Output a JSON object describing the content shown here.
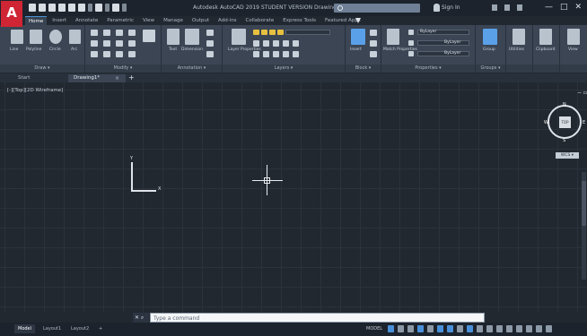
{
  "window": {
    "app_logo": "A",
    "title": "Autodesk AutoCAD 2019  STUDENT VERSION   Drawing1.dwg",
    "signin": "Sign In",
    "controls": [
      "—",
      "□",
      "✕"
    ]
  },
  "ribbon": {
    "tabs": [
      "Home",
      "Insert",
      "Annotate",
      "Parametric",
      "View",
      "Manage",
      "Output",
      "Add-ins",
      "Collaborate",
      "Express Tools",
      "Featured Apps"
    ],
    "active_tab": "Home",
    "panels": [
      {
        "title": "Draw ▾",
        "tools": [
          "Line",
          "Polyline",
          "Circle",
          "Arc"
        ]
      },
      {
        "title": "Modify ▾",
        "tools": []
      },
      {
        "title": "Annotation ▾",
        "tools": [
          "Text",
          "Dimension"
        ]
      },
      {
        "title": "Layers ▾",
        "tools": [
          "Layer Properties"
        ]
      },
      {
        "title": "Block ▾",
        "tools": [
          "Insert"
        ]
      },
      {
        "title": "Properties ▾",
        "tools": [
          "Match Properties"
        ],
        "combos": [
          "ByLayer",
          "ByLayer",
          "ByLayer"
        ]
      },
      {
        "title": "Groups ▾",
        "tools": [
          "Group"
        ]
      },
      {
        "title": "",
        "tools": [
          "Utilities"
        ]
      },
      {
        "title": "",
        "tools": [
          "Clipboard"
        ]
      },
      {
        "title": "",
        "tools": [
          "View"
        ]
      }
    ]
  },
  "file_tabs": {
    "start": "Start",
    "active": "Drawing1*",
    "close": "×",
    "new": "+"
  },
  "canvas": {
    "viewport_label": "[-][Top][2D Wireframe]",
    "ucs_x": "X",
    "ucs_y": "Y",
    "viewcube": {
      "face": "TOP",
      "n": "N",
      "s": "S",
      "e": "E",
      "w": "W"
    },
    "wcs": "WCS ▾"
  },
  "command_line": {
    "icons": "✕ ⌕",
    "placeholder": "Type a command"
  },
  "status_bar": {
    "layout_tabs": [
      "Model",
      "Layout1",
      "Layout2",
      "+"
    ],
    "active_tab": "Model",
    "model_label": "MODEL"
  }
}
